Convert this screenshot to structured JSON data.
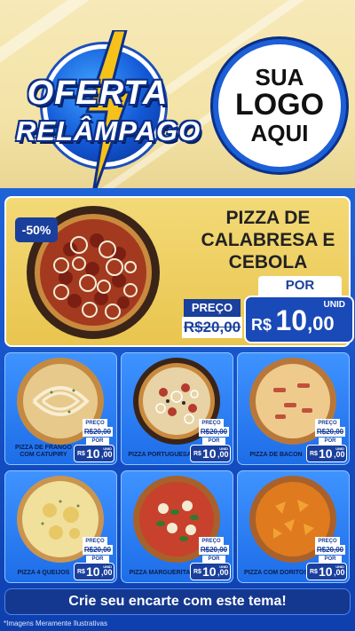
{
  "header": {
    "offer_line1": "OFERTA",
    "offer_line2": "RELÂMPAGO",
    "logo_line1": "SUA",
    "logo_line2": "LOGO",
    "logo_line3": "AQUI"
  },
  "featured": {
    "discount": "-50%",
    "title": "PIZZA DE CALABRESA E CEBOLA",
    "preco_label": "PREÇO",
    "old_price": "R$20,00",
    "por_label": "POR",
    "unid_label": "UNID",
    "price_currency": "R$",
    "price_int": "10",
    "price_cents": ",00"
  },
  "products": [
    {
      "name": "PIZZA DE FRANGO COM CATUPIRY",
      "preco_label": "PREÇO",
      "old_price": "R$20,00",
      "por_label": "POR",
      "currency": "R$",
      "price_int": "10",
      "price_cents": ",00",
      "unid": "UNID"
    },
    {
      "name": "PIZZA PORTUGUESA",
      "preco_label": "PREÇO",
      "old_price": "R$20,00",
      "por_label": "POR",
      "currency": "R$",
      "price_int": "10",
      "price_cents": ",00",
      "unid": "UNID"
    },
    {
      "name": "PIZZA DE BACON",
      "preco_label": "PREÇO",
      "old_price": "R$20,00",
      "por_label": "POR",
      "currency": "R$",
      "price_int": "10",
      "price_cents": ",00",
      "unid": "UNID"
    },
    {
      "name": "PIZZA 4 QUEIJOS",
      "preco_label": "PREÇO",
      "old_price": "R$20,00",
      "por_label": "POR",
      "currency": "R$",
      "price_int": "10",
      "price_cents": ",00",
      "unid": "UNID"
    },
    {
      "name": "PIZZA MARGUERITA",
      "preco_label": "PREÇO",
      "old_price": "R$20,00",
      "por_label": "POR",
      "currency": "R$",
      "price_int": "10",
      "price_cents": ",00",
      "unid": "UNID"
    },
    {
      "name": "PIZZA COM DORITOS",
      "preco_label": "PREÇO",
      "old_price": "R$20,00",
      "por_label": "POR",
      "currency": "R$",
      "price_int": "10",
      "price_cents": ",00",
      "unid": "UNID"
    }
  ],
  "cta": "Crie seu encarte com este tema!",
  "disclaimer": "*Imagens Meramente Ilustrativas",
  "colors": {
    "brand_blue": "#1a3f9c",
    "accent_yellow": "#e9c54e",
    "header_cream": "#f3e3a6"
  }
}
